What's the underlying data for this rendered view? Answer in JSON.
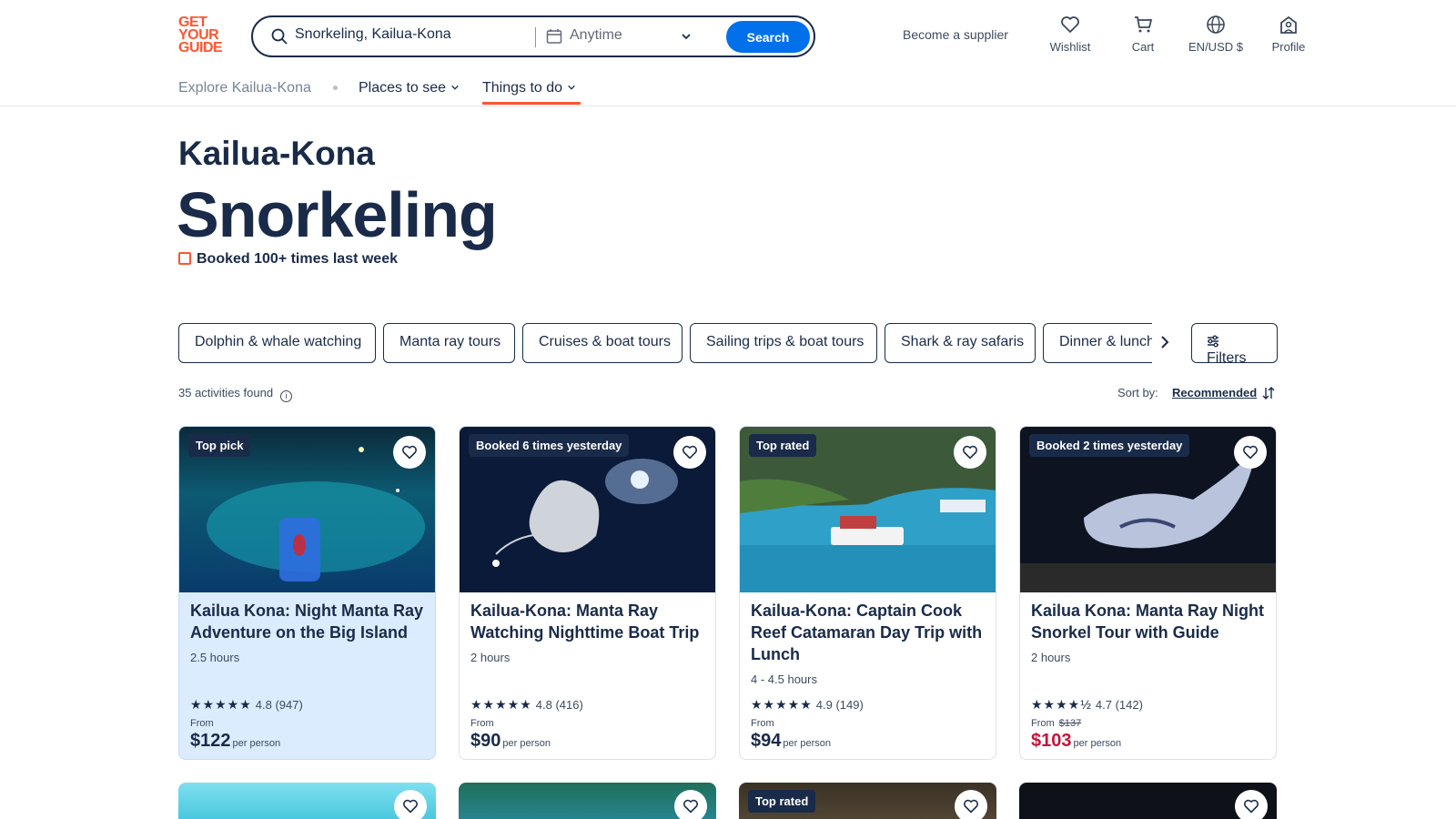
{
  "header": {
    "logo_lines": [
      "GET",
      "YOUR",
      "GUIDE"
    ],
    "search": {
      "value": "Snorkeling, Kailua-Kona",
      "date": "Anytime",
      "button": "Search"
    },
    "become_supplier": "Become a supplier",
    "wishlist": "Wishlist",
    "cart": "Cart",
    "locale": "EN/USD $",
    "profile": "Profile"
  },
  "subnav": {
    "explore": "Explore Kailua-Kona",
    "places": "Places to see",
    "things": "Things to do"
  },
  "title": {
    "city": "Kailua-Kona",
    "activity": "Snorkeling",
    "booked": "Booked 100+ times last week"
  },
  "chips": [
    "Dolphin & whale watching",
    "Manta ray tours",
    "Cruises & boat tours",
    "Sailing trips & boat tours",
    "Shark & ray safaris",
    "Dinner & lunch"
  ],
  "filters_label": "Filters",
  "results": {
    "count_text": "35 activities found",
    "sort_label": "Sort by:",
    "sort_value": "Recommended"
  },
  "cards": [
    {
      "badge": "Top pick",
      "title": "Kailua Kona: Night Manta Ray Adventure on the Big Island",
      "duration": "2.5 hours",
      "stars": "★★★★★",
      "rating": "4.8",
      "reviews": "(947)",
      "from": "From",
      "old_price": "",
      "price": "$122",
      "per": "per person"
    },
    {
      "badge": "Booked 6 times yesterday",
      "title": "Kailua-Kona: Manta Ray Watching Nighttime Boat Trip",
      "duration": "2 hours",
      "stars": "★★★★★",
      "rating": "4.8",
      "reviews": "(416)",
      "from": "From",
      "old_price": "",
      "price": "$90",
      "per": "per person"
    },
    {
      "badge": "Top rated",
      "title": "Kailua-Kona: Captain Cook Reef Catamaran Day Trip with Lunch",
      "duration": "4 - 4.5 hours",
      "stars": "★★★★★",
      "rating": "4.9",
      "reviews": "(149)",
      "from": "From",
      "old_price": "",
      "price": "$94",
      "per": "per person"
    },
    {
      "badge": "Booked 2 times yesterday",
      "title": "Kailua Kona: Manta Ray Night Snorkel Tour with Guide",
      "duration": "2 hours",
      "stars": "★★★★½",
      "rating": "4.7",
      "reviews": "(142)",
      "from": "From",
      "old_price": "$137",
      "price": "$103",
      "per": "per person"
    }
  ],
  "second_row": {
    "badge_3": "Top rated"
  },
  "colors": {
    "brand": "#ff5533",
    "primary_blue": "#0071eb",
    "navy": "#1a2b49",
    "sale": "#c4153b",
    "highlight": "#dbecff"
  }
}
